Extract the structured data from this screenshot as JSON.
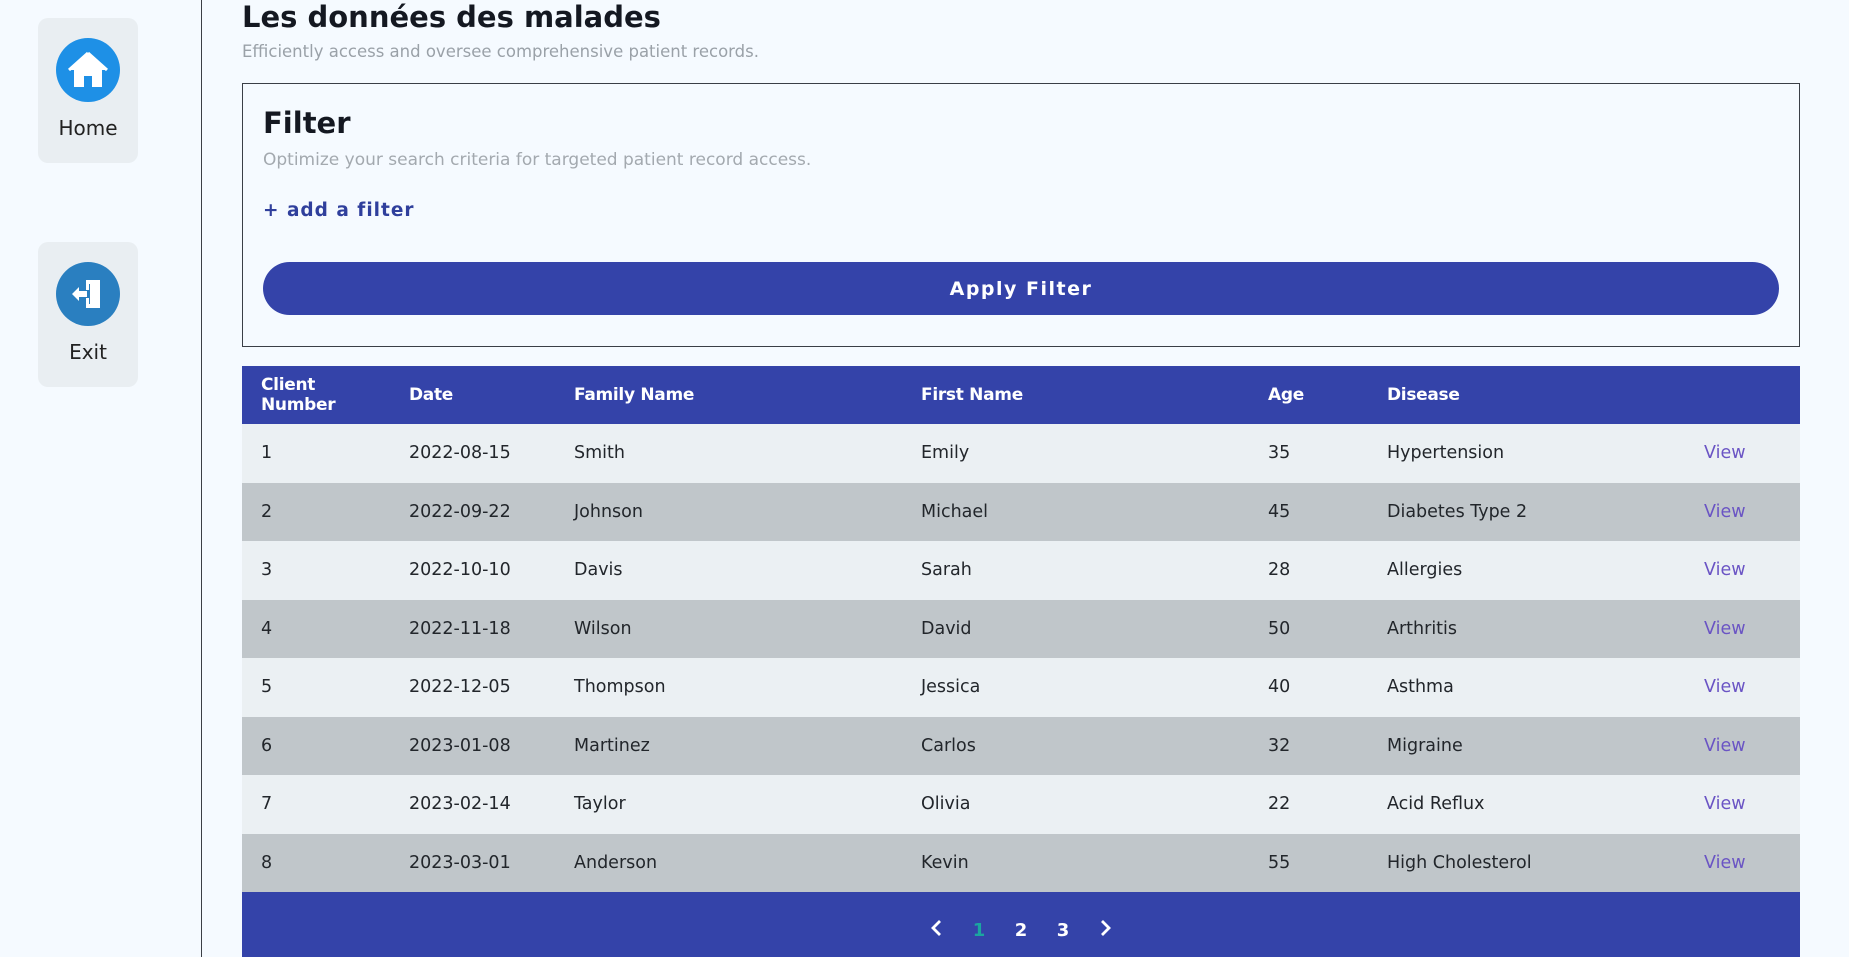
{
  "sidebar": {
    "items": [
      {
        "label": "Home",
        "icon": "home-icon"
      },
      {
        "label": "Exit",
        "icon": "exit-icon"
      }
    ]
  },
  "header": {
    "title": "Les données des malades",
    "subtitle": "Efficiently access and oversee comprehensive patient records."
  },
  "filter": {
    "title": "Filter",
    "subtitle": "Optimize your search criteria for targeted patient record access.",
    "add_label": "+ add a filter",
    "apply_label": "Apply Filter"
  },
  "table": {
    "columns": [
      "Client Number",
      "Date",
      "Family Name",
      "First Name",
      "Age",
      "Disease",
      ""
    ],
    "view_label": "View",
    "rows": [
      {
        "num": "1",
        "date": "2022-08-15",
        "family": "Smith",
        "first": "Emily",
        "age": "35",
        "disease": "Hypertension"
      },
      {
        "num": "2",
        "date": "2022-09-22",
        "family": "Johnson",
        "first": "Michael",
        "age": "45",
        "disease": "Diabetes Type 2"
      },
      {
        "num": "3",
        "date": "2022-10-10",
        "family": "Davis",
        "first": "Sarah",
        "age": "28",
        "disease": "Allergies"
      },
      {
        "num": "4",
        "date": "2022-11-18",
        "family": "Wilson",
        "first": "David",
        "age": "50",
        "disease": "Arthritis"
      },
      {
        "num": "5",
        "date": "2022-12-05",
        "family": "Thompson",
        "first": "Jessica",
        "age": "40",
        "disease": "Asthma"
      },
      {
        "num": "6",
        "date": "2023-01-08",
        "family": "Martinez",
        "first": "Carlos",
        "age": "32",
        "disease": "Migraine"
      },
      {
        "num": "7",
        "date": "2023-02-14",
        "family": "Taylor",
        "first": "Olivia",
        "age": "22",
        "disease": "Acid Reflux"
      },
      {
        "num": "8",
        "date": "2023-03-01",
        "family": "Anderson",
        "first": "Kevin",
        "age": "55",
        "disease": "High Cholesterol"
      }
    ]
  },
  "pagination": {
    "pages": [
      "1",
      "2",
      "3"
    ],
    "current": "1",
    "prev_icon": "chevron-left-icon",
    "next_icon": "chevron-right-icon"
  },
  "colors": {
    "primary": "#3443a9",
    "home_icon_bg": "#1e90e6",
    "exit_icon_bg": "#2a7fc0",
    "active_page": "#1ba6a0",
    "view_link": "#6a54c4"
  }
}
